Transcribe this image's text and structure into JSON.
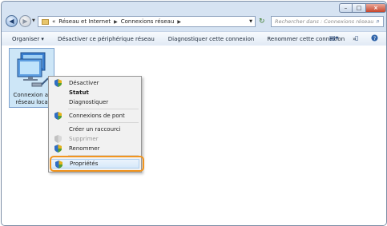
{
  "window": {
    "controls": {
      "minimize": "–",
      "maximize": "□",
      "close": "×"
    }
  },
  "nav": {
    "back_glyph": "◀",
    "forward_glyph": "▶",
    "breadcrumb": {
      "prefix": "«",
      "items": [
        "Réseau et Internet",
        "Connexions réseau"
      ],
      "separator": "▶"
    },
    "refresh_glyph": "↻",
    "search_placeholder": "Rechercher dans : Connexions réseau",
    "search_glyph": "⌕"
  },
  "toolbar": {
    "organize": "Organiser ▾",
    "disable": "Désactiver ce périphérique réseau",
    "diagnose": "Diagnostiquer cette connexion",
    "rename": "Renommer cette connexion",
    "more": "»"
  },
  "item": {
    "label_line1": "Connexion au",
    "label_line2": "réseau local"
  },
  "context_menu": {
    "items": [
      {
        "label": "Désactiver",
        "shield": true
      },
      {
        "label": "Statut",
        "bold": true
      },
      {
        "label": "Diagnostiquer"
      },
      {
        "label": "Connexions de pont",
        "shield": true
      },
      {
        "label": "Créer un raccourci"
      },
      {
        "label": "Supprimer",
        "shield": true,
        "disabled": true
      },
      {
        "label": "Renommer",
        "shield": true
      },
      {
        "label": "Propriétés",
        "shield": true,
        "highlighted": true
      }
    ]
  },
  "colors": {
    "highlight_ring": "#f2951f",
    "selection": "#cde6f7"
  }
}
